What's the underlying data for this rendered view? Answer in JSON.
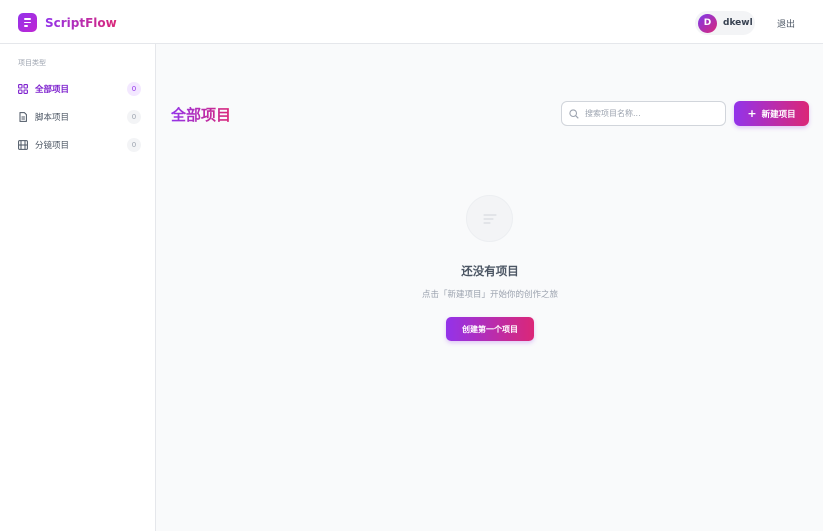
{
  "app": {
    "name": "ScriptFlow"
  },
  "user": {
    "avatar_initial": "D",
    "username": "dkewl",
    "logout_label": "退出"
  },
  "sidebar": {
    "heading": "项目类型",
    "items": [
      {
        "label": "全部项目",
        "count": "0",
        "icon": "grid-icon",
        "active": true
      },
      {
        "label": "脚本项目",
        "count": "0",
        "icon": "document-icon",
        "active": false
      },
      {
        "label": "分镜项目",
        "count": "0",
        "icon": "film-icon",
        "active": false
      }
    ]
  },
  "main": {
    "title": "全部项目",
    "search": {
      "placeholder": "搜索项目名称...",
      "value": ""
    },
    "new_button": {
      "plus": "+",
      "label": "新建项目"
    },
    "empty_state": {
      "icon": "list-icon",
      "title": "还没有项目",
      "subtitle": "点击「新建项目」开始你的创作之旅",
      "button_label": "创建第一个项目"
    }
  },
  "colors": {
    "accent_start": "#9333ea",
    "accent_end": "#db2777",
    "active_text": "#7e22ce"
  }
}
